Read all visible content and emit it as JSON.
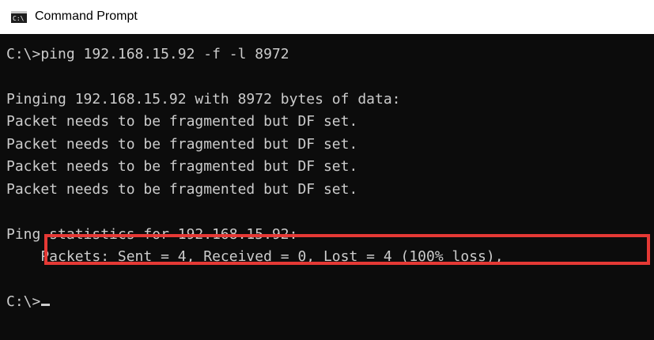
{
  "window": {
    "title": "Command Prompt",
    "icon": "cmd-console-icon"
  },
  "console": {
    "lines": [
      "C:\\>ping 192.168.15.92 -f -l 8972",
      "",
      "Pinging 192.168.15.92 with 8972 bytes of data:",
      "Packet needs to be fragmented but DF set.",
      "Packet needs to be fragmented but DF set.",
      "Packet needs to be fragmented but DF set.",
      "Packet needs to be fragmented but DF set.",
      "",
      "Ping statistics for 192.168.15.92:",
      "    Packets: Sent = 4, Received = 0, Lost = 4 (100% loss),",
      "",
      "C:\\>"
    ]
  },
  "colors": {
    "console_background": "#0c0c0c",
    "console_text": "#cccccc",
    "highlight_border": "#e53935"
  }
}
